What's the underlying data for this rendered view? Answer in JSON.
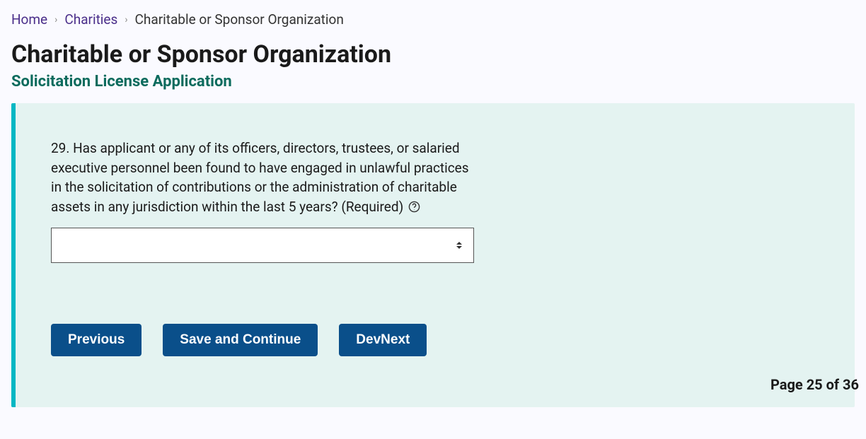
{
  "breadcrumb": {
    "home": "Home",
    "charities": "Charities",
    "current": "Charitable or Sponsor Organization"
  },
  "page": {
    "title": "Charitable or Sponsor Organization",
    "subtitle": "Solicitation License Application"
  },
  "form": {
    "question29_text": "29. Has applicant or any of its officers, directors, trustees, or salaried executive personnel been found to have engaged in unlawful practices in the solicitation of contributions or the administration of charitable assets in any jurisdiction within the last 5 years?",
    "required_label": "(Required)",
    "q29_value": ""
  },
  "buttons": {
    "previous": "Previous",
    "save_continue": "Save and Continue",
    "dev_next": "DevNext"
  },
  "pager": {
    "text": "Page 25 of 36"
  }
}
